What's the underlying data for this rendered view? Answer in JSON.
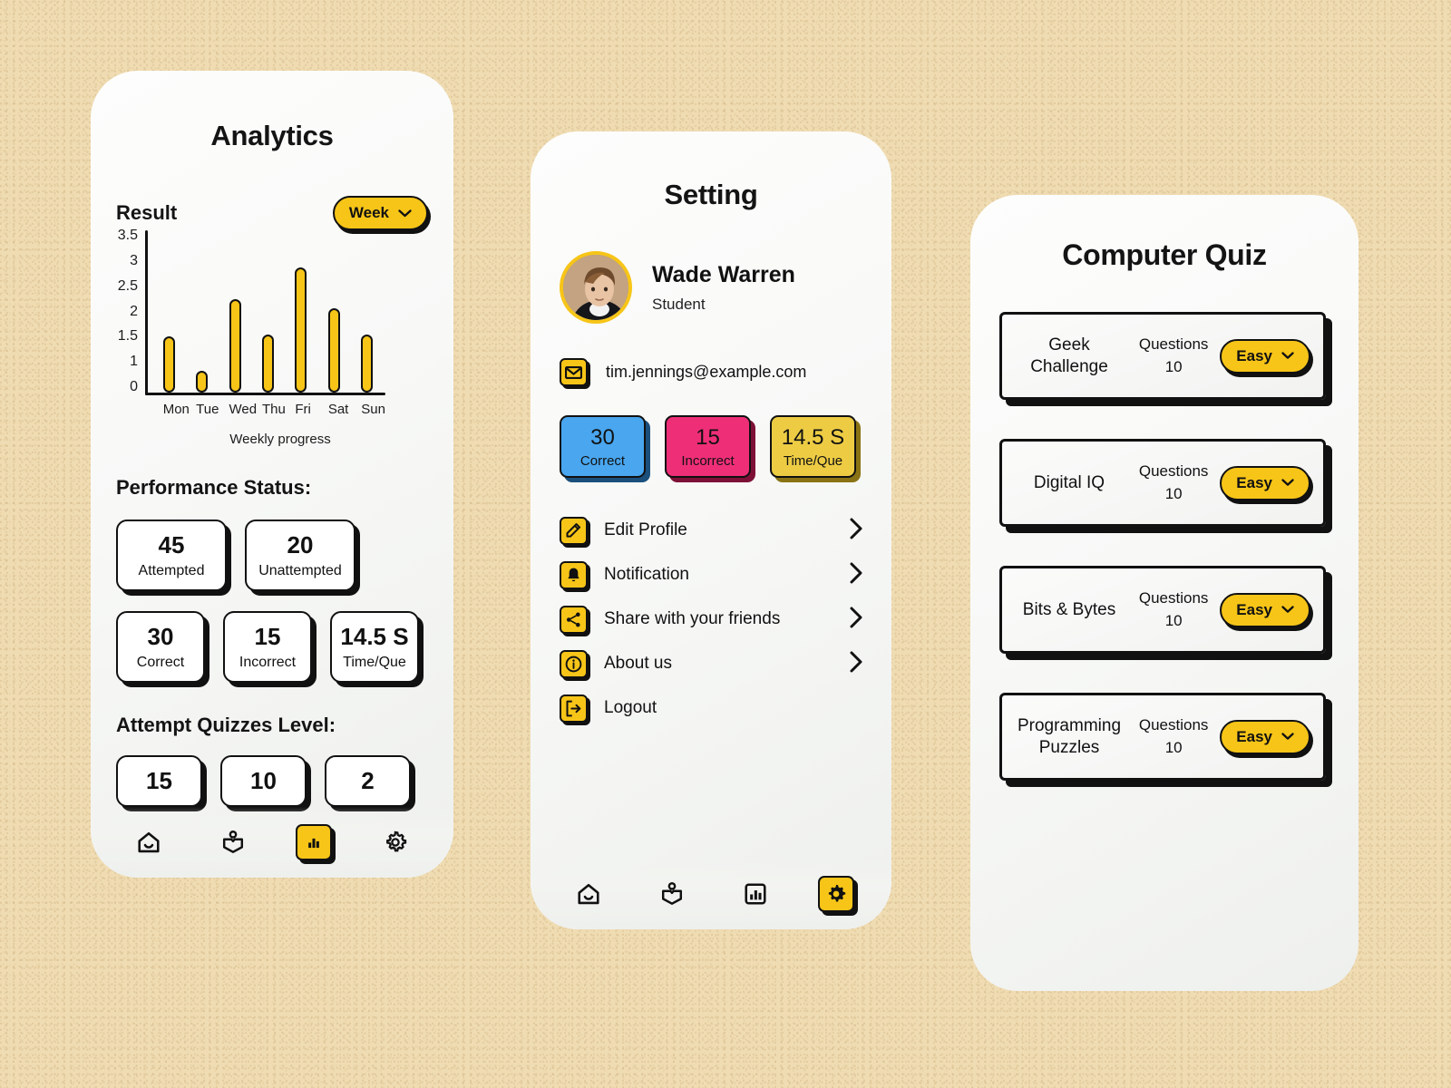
{
  "theme": {
    "background": "#f0dcb2",
    "accent_yellow": "#f7c518",
    "ink": "#111111",
    "card_blue": "#49a6ef",
    "card_pink": "#ef2e78",
    "card_yellow": "#edcc44"
  },
  "analytics": {
    "title": "Analytics",
    "result_label": "Result",
    "range_button": {
      "label": "Week",
      "icon": "chevron-down-icon"
    },
    "performance_heading": "Performance Status:",
    "performance_row1": [
      {
        "value": "45",
        "label": "Attempted"
      },
      {
        "value": "20",
        "label": "Unattempted"
      }
    ],
    "performance_row2": [
      {
        "value": "30",
        "label": "Correct"
      },
      {
        "value": "15",
        "label": "Incorrect"
      },
      {
        "value": "14.5 S",
        "label": "Time/Que"
      }
    ],
    "levels_heading": "Attempt Quizzes Level:",
    "levels": [
      {
        "value": "15"
      },
      {
        "value": "10"
      },
      {
        "value": "2"
      }
    ],
    "nav": [
      {
        "icon": "home-icon",
        "active": false
      },
      {
        "icon": "learning-icon",
        "active": false
      },
      {
        "icon": "chart-icon",
        "active": true
      },
      {
        "icon": "gear-icon",
        "active": false
      }
    ]
  },
  "chart_data": {
    "type": "bar",
    "title": "Result",
    "xlabel": "Weekly progress",
    "ylabel": "",
    "categories": [
      "Mon",
      "Tue",
      "Wed",
      "Thu",
      "Fri",
      "Sat",
      "Sun"
    ],
    "values": [
      1.3,
      0.5,
      2.15,
      1.35,
      2.9,
      1.95,
      1.35
    ],
    "ytick_labels": [
      "3.5",
      "3",
      "2.5",
      "2",
      "1.5",
      "1",
      "0"
    ],
    "ytick_values": [
      3.5,
      3,
      2.5,
      2,
      1.5,
      1,
      0
    ],
    "ylim": [
      0,
      3.5
    ],
    "grid": false,
    "legend": false,
    "bar_color": "#f7c518",
    "bar_edge_color": "#111111"
  },
  "setting": {
    "title": "Setting",
    "profile": {
      "name": "Wade Warren",
      "role": "Student",
      "avatar": "user-avatar"
    },
    "email": {
      "icon": "mail-icon",
      "value": "tim.jennings@example.com"
    },
    "stats": [
      {
        "value": "30",
        "label": "Correct",
        "color": "#49a6ef",
        "shadow": "#1b4f7c"
      },
      {
        "value": "15",
        "label": "Incorrect",
        "color": "#ef2e78",
        "shadow": "#7d1036"
      },
      {
        "value": "14.5 S",
        "label": "Time/Que",
        "color": "#edcc44",
        "shadow": "#8a7314"
      }
    ],
    "menu": [
      {
        "label": "Edit Profile",
        "icon": "pencil-icon",
        "chevron": true
      },
      {
        "label": "Notification",
        "icon": "bell-icon",
        "chevron": true
      },
      {
        "label": "Share with your friends",
        "icon": "share-icon",
        "chevron": true
      },
      {
        "label": "About us",
        "icon": "info-icon",
        "chevron": true
      },
      {
        "label": "Logout",
        "icon": "logout-icon",
        "chevron": false
      }
    ],
    "nav": [
      {
        "icon": "home-icon",
        "active": false
      },
      {
        "icon": "learning-icon",
        "active": false
      },
      {
        "icon": "chart-icon",
        "active": false
      },
      {
        "icon": "gear-icon",
        "active": true
      }
    ]
  },
  "quiz": {
    "title": "Computer Quiz",
    "questions_label": "Questions",
    "cards": [
      {
        "name": "Geek Challenge",
        "questions": "10",
        "difficulty": "Easy"
      },
      {
        "name": "Digital IQ",
        "questions": "10",
        "difficulty": "Easy"
      },
      {
        "name": "Bits & Bytes",
        "questions": "10",
        "difficulty": "Easy"
      },
      {
        "name": "Programming Puzzles",
        "questions": "10",
        "difficulty": "Easy"
      }
    ]
  }
}
